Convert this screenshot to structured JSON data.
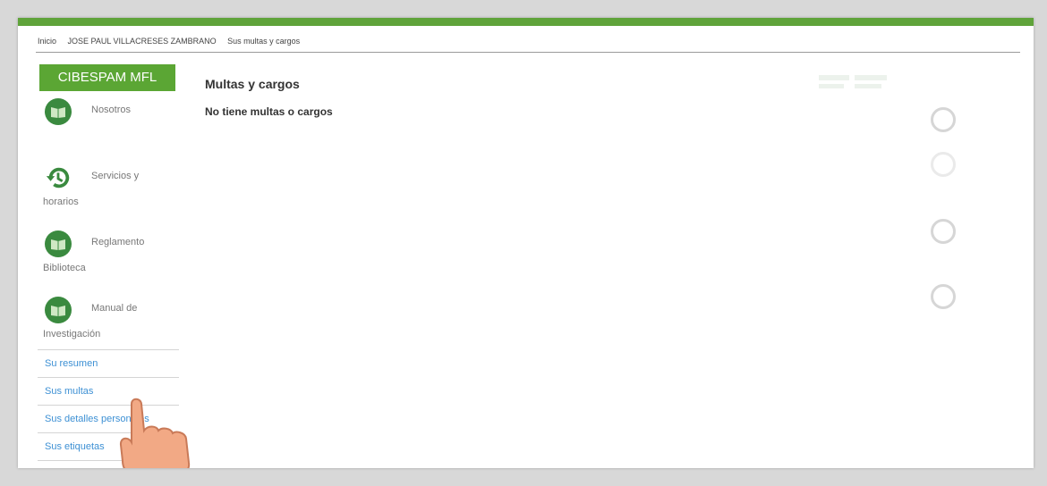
{
  "breadcrumb": {
    "items": [
      "Inicio",
      "JOSE PAUL VILLACRESES ZAMBRANO",
      "Sus multas y cargos"
    ]
  },
  "sidebar": {
    "brand": "CIBESPAM MFL",
    "nav": [
      {
        "line1": "Nosotros",
        "line2": "",
        "icon": "book-icon"
      },
      {
        "line1": "Servicios y",
        "line2": "horarios",
        "icon": "history-clock-icon"
      },
      {
        "line1": "Reglamento",
        "line2": "Biblioteca",
        "icon": "book-icon"
      },
      {
        "line1": "Manual de",
        "line2": "Investigación",
        "icon": "book-icon"
      }
    ],
    "links": [
      "Su resumen",
      "Sus multas",
      "Sus detalles personales",
      "Sus etiquetas"
    ]
  },
  "main": {
    "title": "Multas y cargos",
    "message": "No tiene multas o cargos"
  },
  "colors": {
    "accent_green": "#5ba634",
    "icon_green": "#3a8a3f",
    "link_blue": "#3d90d4"
  }
}
